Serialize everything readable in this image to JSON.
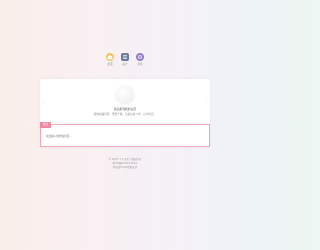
{
  "nav": {
    "items": [
      {
        "label": "主页",
        "icon": "home-icon",
        "color": "#f3c45a"
      },
      {
        "label": "关于",
        "icon": "info-icon",
        "color": "#6f7c9e"
      },
      {
        "label": "分享",
        "icon": "share-icon",
        "color": "#8e79c9"
      }
    ]
  },
  "card": {
    "title": "欢迎来到我的主页",
    "description": "愿你走遍世界，历经千帆，归来仍是少年，心中有光。",
    "input_tag": "留言",
    "input_text": "在此输入你想说的话..."
  },
  "footer": {
    "line1": "© 2023 个人主页 | 版权所有",
    "line2": "粤ICP备XXXXXXXX号",
    "line3": "本站由XXXX提供支持"
  },
  "colors": {
    "accent": "#f08aa0"
  }
}
